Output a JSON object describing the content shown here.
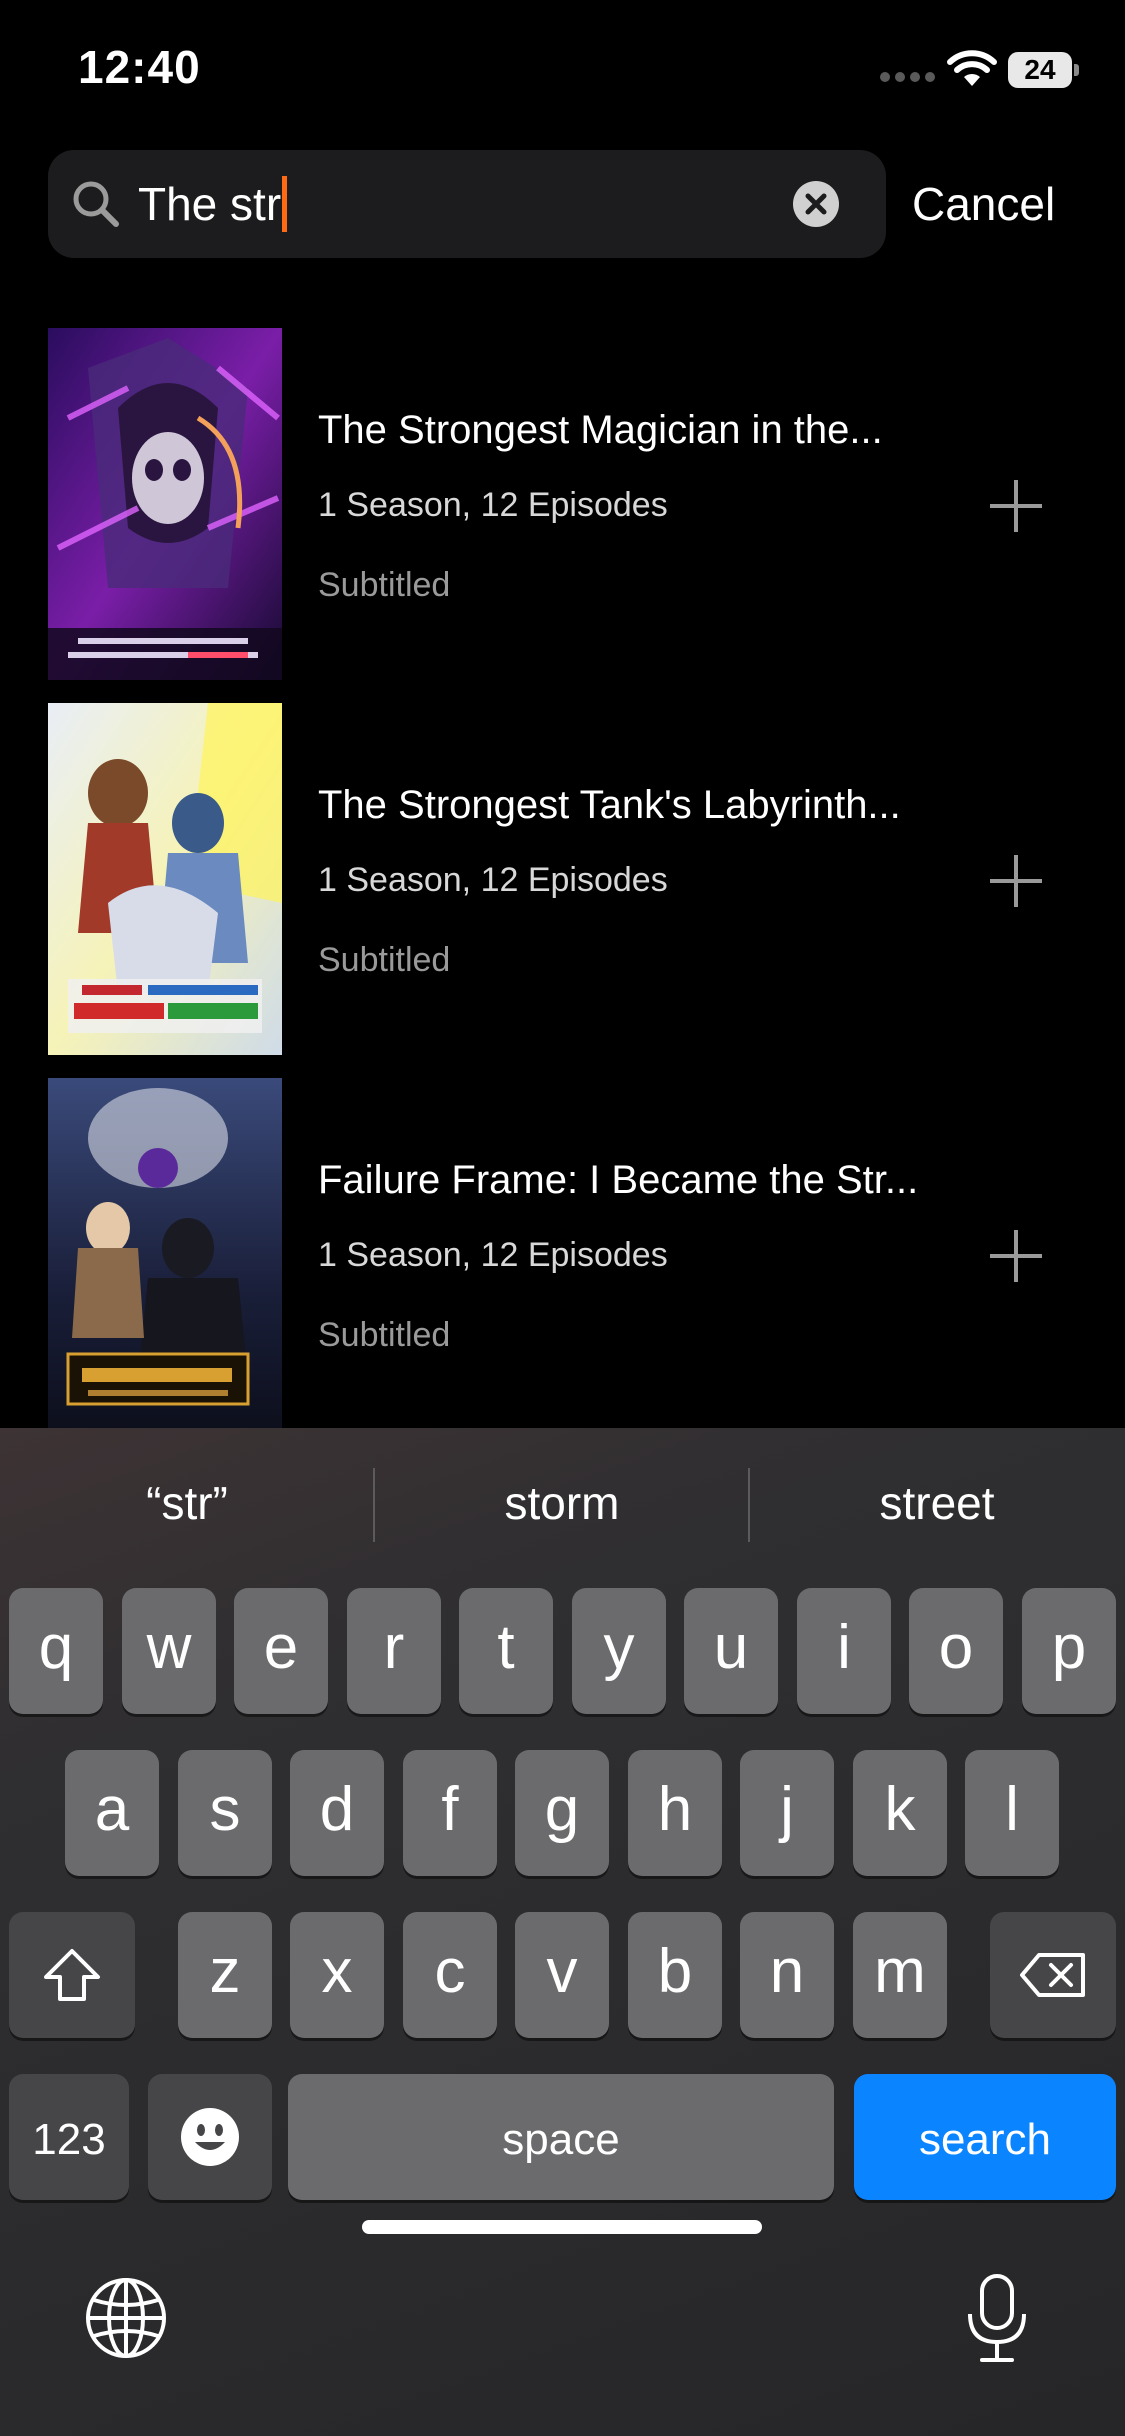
{
  "status_bar": {
    "time": "12:40",
    "battery": "24"
  },
  "search": {
    "query": "The str",
    "cancel_label": "Cancel"
  },
  "results": [
    {
      "title": "The Strongest Magician in the...",
      "meta": "1 Season, 12 Episodes",
      "subtitle": "Subtitled"
    },
    {
      "title": "The Strongest Tank's Labyrinth...",
      "meta": "1 Season, 12 Episodes",
      "subtitle": "Subtitled"
    },
    {
      "title": "Failure Frame: I Became the Str...",
      "meta": "1 Season, 12 Episodes",
      "subtitle": "Subtitled"
    }
  ],
  "keyboard": {
    "suggestions": [
      "“str”",
      "storm",
      "street"
    ],
    "row1": [
      "q",
      "w",
      "e",
      "r",
      "t",
      "y",
      "u",
      "i",
      "o",
      "p"
    ],
    "row2": [
      "a",
      "s",
      "d",
      "f",
      "g",
      "h",
      "j",
      "k",
      "l"
    ],
    "row3": [
      "z",
      "x",
      "c",
      "v",
      "b",
      "n",
      "m"
    ],
    "numbers_label": "123",
    "space_label": "space",
    "action_label": "search"
  },
  "colors": {
    "accent_caret": "#ff6a13",
    "search_key": "#0a84ff"
  }
}
